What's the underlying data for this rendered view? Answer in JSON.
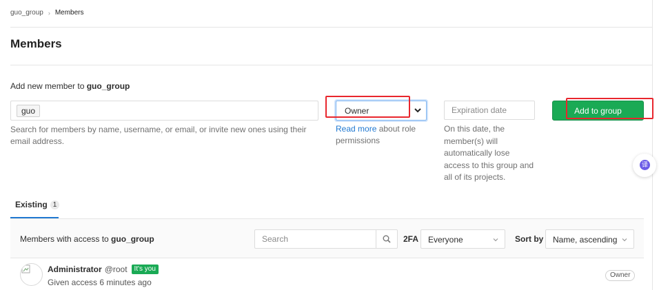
{
  "breadcrumb": {
    "group": "guo_group",
    "current": "Members"
  },
  "page_title": "Members",
  "add_member": {
    "label_prefix": "Add new member to ",
    "group_name": "guo_group",
    "token": "guo",
    "help": "Search for members by name, username, or email, or invite new ones using their email address.",
    "role_value": "Owner",
    "role_help_link": "Read more",
    "role_help_rest": " about role permissions",
    "expiration_placeholder": "Expiration date",
    "expiration_help": "On this date, the member(s) will automatically lose access to this group and all of its projects.",
    "submit_label": "Add to group"
  },
  "float_button_glyph": "译",
  "tabs": [
    {
      "label": "Existing",
      "count": "1"
    }
  ],
  "members_panel": {
    "title_prefix": "Members with access to ",
    "group_name": "guo_group",
    "search_placeholder": "Search",
    "twofa_label": "2FA",
    "twofa_value": "Everyone",
    "sort_label": "Sort by",
    "sort_value": "Name, ascending"
  },
  "members": [
    {
      "name": "Administrator",
      "username": "@root",
      "badge": "It's you",
      "given": "Given access 6 minutes ago",
      "role": "Owner"
    }
  ],
  "colors": {
    "primary_green": "#1aaa55",
    "link_blue": "#1f78d1",
    "highlight_red": "#e8262d"
  }
}
